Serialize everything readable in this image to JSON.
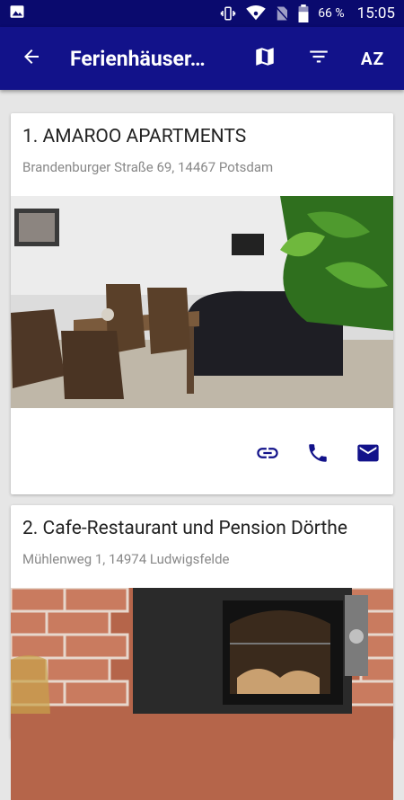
{
  "statusbar": {
    "battery_text": "66 %",
    "time": "15:05",
    "icons": [
      "image-icon",
      "vibrate-icon",
      "wifi-icon",
      "no-sim-icon",
      "battery-icon"
    ]
  },
  "toolbar": {
    "title": "Ferienhäuser…",
    "actions": [
      "back-arrow-icon",
      "map-icon",
      "filter-icon",
      "sort-az-icon"
    ],
    "sort_label": "AZ"
  },
  "listings": [
    {
      "title": "1. AMAROO APARTMENTS",
      "address": "Brandenburger Straße 69, 14467 Potsdam",
      "actions": [
        "link-icon",
        "phone-icon",
        "email-icon"
      ]
    },
    {
      "title": "2. Cafe-Restaurant und Pension Dörthe",
      "address": "Mühlenweg 1, 14974 Ludwigsfelde"
    }
  ],
  "colors": {
    "statusbar": "#0a0a6e",
    "toolbar": "#12128a",
    "icon_accent": "#12128a",
    "background": "#e6e6e6"
  }
}
